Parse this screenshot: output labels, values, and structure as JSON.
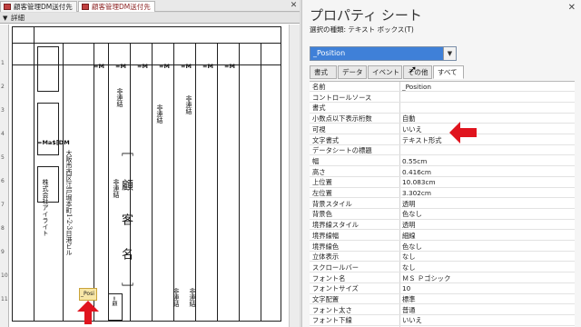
{
  "tabs": [
    {
      "label": "顧客管理DM送付先",
      "active": false
    },
    {
      "label": "顧客管理DM送付先",
      "active": true
    }
  ],
  "section": {
    "label": "詳細"
  },
  "ruler": {
    "marks": [
      "1",
      "2",
      "3",
      "4",
      "5",
      "6",
      "7",
      "8",
      "9",
      "10",
      "11"
    ]
  },
  "labels": {
    "fields_tag": "=Ma$[DM",
    "unbound_1": "非連結",
    "unbound_2": "非連結",
    "unbound_3": "非連結",
    "unbound_4": "非連結",
    "unbound_5": "非連結",
    "unbound_6": "非連結",
    "company": "株式会社アイライト",
    "address": "大阪市西区江戸堀本町1-2-3日港ビル",
    "customer_name": "［　顧　客　名　］",
    "position_ctrl": "_Posi",
    "small_tag": "=顧"
  },
  "properties": {
    "title": "プロパティ シート",
    "selection_type": "選択の種類:  テキスト ボックス(T)",
    "selected_control": "_Position",
    "tabs": [
      "書式",
      "データ",
      "イベント",
      "その他",
      "すべて"
    ],
    "rows": [
      {
        "k": "名前",
        "v": "_Position"
      },
      {
        "k": "コントロールソース",
        "v": ""
      },
      {
        "k": "書式",
        "v": ""
      },
      {
        "k": "小数点以下表示桁数",
        "v": "自動"
      },
      {
        "k": "可視",
        "v": "いいえ"
      },
      {
        "k": "文字書式",
        "v": "テキスト形式"
      },
      {
        "k": "データシートの標題",
        "v": ""
      },
      {
        "k": "幅",
        "v": "0.55cm"
      },
      {
        "k": "高さ",
        "v": "0.416cm"
      },
      {
        "k": "上位置",
        "v": "10.083cm"
      },
      {
        "k": "左位置",
        "v": "3.302cm"
      },
      {
        "k": "背景スタイル",
        "v": "透明"
      },
      {
        "k": "背景色",
        "v": "色なし"
      },
      {
        "k": "境界線スタイル",
        "v": "透明"
      },
      {
        "k": "境界線幅",
        "v": "細線"
      },
      {
        "k": "境界線色",
        "v": "色なし"
      },
      {
        "k": "立体表示",
        "v": "なし"
      },
      {
        "k": "スクロールバー",
        "v": "なし"
      },
      {
        "k": "フォント名",
        "v": "ＭＳ Ｐゴシック"
      },
      {
        "k": "フォントサイズ",
        "v": "10"
      },
      {
        "k": "文字配置",
        "v": "標準"
      },
      {
        "k": "フォント太さ",
        "v": "普通"
      },
      {
        "k": "フォント下線",
        "v": "いいえ"
      }
    ]
  },
  "colors": {
    "accent": "#3f80d8",
    "arrow": "#e0141e"
  }
}
